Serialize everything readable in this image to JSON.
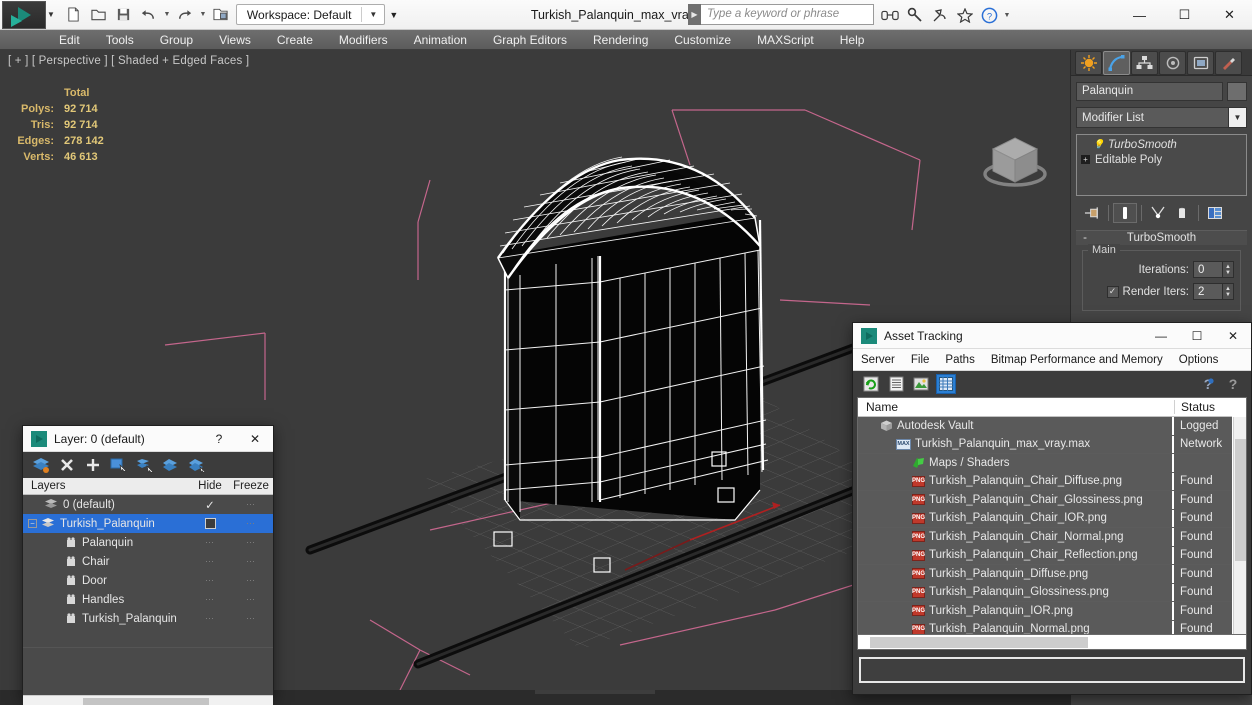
{
  "titlebar": {
    "app_icon": "3dsmax-logo-icon",
    "quick_access": [
      {
        "name": "new-file-button",
        "glyph": "new-icon"
      },
      {
        "name": "open-file-button",
        "glyph": "open-icon"
      },
      {
        "name": "save-file-button",
        "glyph": "save-icon"
      },
      {
        "name": "undo-button",
        "glyph": "undo-icon"
      },
      {
        "name": "redo-button",
        "glyph": "redo-icon"
      },
      {
        "name": "set-project-folder-button",
        "glyph": "project-icon"
      }
    ],
    "workspace_label": "Workspace: Default",
    "document_title": "Turkish_Palanquin_max_vray.max",
    "search_placeholder": "Type a keyword or phrase",
    "right_icons": [
      "binoculars-icon",
      "wrench-icon",
      "satellite-icon",
      "star-icon",
      "help-icon"
    ],
    "window_controls": {
      "minimize": "—",
      "maximize": "☐",
      "close": "✕"
    }
  },
  "menubar": {
    "items": [
      "Edit",
      "Tools",
      "Group",
      "Views",
      "Create",
      "Modifiers",
      "Animation",
      "Graph Editors",
      "Rendering",
      "Customize",
      "MAXScript",
      "Help"
    ]
  },
  "viewport": {
    "label": "[ + ] [ Perspective ] [ Shaded + Edged Faces ]",
    "stats": {
      "header": "Total",
      "rows": [
        {
          "key": "Polys:",
          "value": "92 714"
        },
        {
          "key": "Tris:",
          "value": "92 714"
        },
        {
          "key": "Edges:",
          "value": "278 142"
        },
        {
          "key": "Verts:",
          "value": "46 613"
        }
      ]
    },
    "viewcube": "viewcube-widget",
    "colors": {
      "background": "#3b3b3b",
      "wireframe": "#ffffff",
      "selection_box": "#c4668c",
      "grid": "#555555"
    }
  },
  "command_panel": {
    "tabs": [
      {
        "name": "create-tab",
        "glyph": "create-icon",
        "active": false
      },
      {
        "name": "modify-tab",
        "glyph": "modify-icon",
        "active": true
      },
      {
        "name": "hierarchy-tab",
        "glyph": "hierarchy-icon",
        "active": false
      },
      {
        "name": "motion-tab",
        "glyph": "motion-icon",
        "active": false
      },
      {
        "name": "display-tab",
        "glyph": "display-icon",
        "active": false
      },
      {
        "name": "utilities-tab",
        "glyph": "utilities-icon",
        "active": false
      }
    ],
    "object_name": "Palanquin",
    "modifier_list_label": "Modifier List",
    "stack": [
      {
        "label": "TurboSmooth",
        "italic": true
      },
      {
        "label": "Editable Poly",
        "italic": false
      }
    ],
    "stack_buttons": [
      "pin-stack-icon",
      "show-end-result-icon",
      "make-unique-icon",
      "remove-modifier-icon",
      "configure-sets-icon"
    ],
    "rollout": {
      "title": "TurboSmooth",
      "collapse_glyph": "-",
      "group_title": "Main",
      "iterations_label": "Iterations:",
      "iterations_value": "0",
      "render_iters_label": "Render Iters:",
      "render_iters_value": "2",
      "render_iters_checked": true
    }
  },
  "layer_dialog": {
    "title": "Layer: 0 (default)",
    "help_glyph": "?",
    "close_glyph": "✕",
    "toolbar": [
      "new-layer-icon",
      "delete-layer-icon",
      "add-layer-icon",
      "select-objects-in-layer-icon",
      "highlight-selected-objects-icon",
      "add-selection-to-layer-icon",
      "set-current-layer-icon"
    ],
    "columns": {
      "name": "Layers",
      "hide": "Hide",
      "freeze": "Freeze"
    },
    "rows": [
      {
        "label": "0 (default)",
        "indent": 0,
        "icon": "layer-icon",
        "selected": false,
        "current": true,
        "hide": "…",
        "freeze": "…"
      },
      {
        "label": "Turkish_Palanquin",
        "indent": 0,
        "icon": "layer-icon",
        "selected": true,
        "current": false,
        "hide": "…",
        "freeze": "…"
      },
      {
        "label": "Palanquin",
        "indent": 1,
        "icon": "object-icon",
        "selected": false,
        "current": false,
        "hide": "…",
        "freeze": "…"
      },
      {
        "label": "Chair",
        "indent": 1,
        "icon": "object-icon",
        "selected": false,
        "current": false,
        "hide": "…",
        "freeze": "…"
      },
      {
        "label": "Door",
        "indent": 1,
        "icon": "object-icon",
        "selected": false,
        "current": false,
        "hide": "…",
        "freeze": "…"
      },
      {
        "label": "Handles",
        "indent": 1,
        "icon": "object-icon",
        "selected": false,
        "current": false,
        "hide": "…",
        "freeze": "…"
      },
      {
        "label": "Turkish_Palanquin",
        "indent": 1,
        "icon": "object-icon",
        "selected": false,
        "current": false,
        "hide": "…",
        "freeze": "…"
      }
    ]
  },
  "asset_tracking": {
    "title": "Asset Tracking",
    "window_controls": {
      "minimize": "—",
      "maximize": "☐",
      "close": "✕"
    },
    "menu": [
      "Server",
      "File",
      "Paths",
      "Bitmap Performance and Memory",
      "Options"
    ],
    "toolbar": [
      {
        "name": "refresh-icon",
        "active": false
      },
      {
        "name": "list-view-icon",
        "active": false
      },
      {
        "name": "bitmap-thumbnail-icon",
        "active": false
      },
      {
        "name": "grid-view-icon",
        "active": true
      }
    ],
    "help_icons": [
      "help-icon",
      "context-help-icon"
    ],
    "columns": {
      "name": "Name",
      "status": "Status"
    },
    "rows": [
      {
        "name": "Autodesk Vault",
        "status": "Logged ",
        "indent": 1,
        "icon": "vault-icon"
      },
      {
        "name": "Turkish_Palanquin_max_vray.max",
        "status": "Network",
        "indent": 2,
        "icon": "max-file-icon"
      },
      {
        "name": "Maps / Shaders",
        "status": "",
        "indent": 3,
        "icon": "maps-shaders-icon"
      },
      {
        "name": "Turkish_Palanquin_Chair_Diffuse.png",
        "status": "Found",
        "indent": 3,
        "icon": "png-icon"
      },
      {
        "name": "Turkish_Palanquin_Chair_Glossiness.png",
        "status": "Found",
        "indent": 3,
        "icon": "png-icon"
      },
      {
        "name": "Turkish_Palanquin_Chair_IOR.png",
        "status": "Found",
        "indent": 3,
        "icon": "png-icon"
      },
      {
        "name": "Turkish_Palanquin_Chair_Normal.png",
        "status": "Found",
        "indent": 3,
        "icon": "png-icon"
      },
      {
        "name": "Turkish_Palanquin_Chair_Reflection.png",
        "status": "Found",
        "indent": 3,
        "icon": "png-icon"
      },
      {
        "name": "Turkish_Palanquin_Diffuse.png",
        "status": "Found",
        "indent": 3,
        "icon": "png-icon"
      },
      {
        "name": "Turkish_Palanquin_Glossiness.png",
        "status": "Found",
        "indent": 3,
        "icon": "png-icon"
      },
      {
        "name": "Turkish_Palanquin_IOR.png",
        "status": "Found",
        "indent": 3,
        "icon": "png-icon"
      },
      {
        "name": "Turkish_Palanquin_Normal.png",
        "status": "Found",
        "indent": 3,
        "icon": "png-icon"
      }
    ],
    "path_field_value": ""
  }
}
